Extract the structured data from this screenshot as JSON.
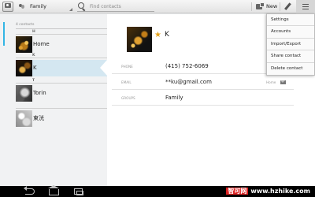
{
  "action_bar": {
    "account_filter": "Family",
    "search_placeholder": "Find contacts",
    "new_label": "New"
  },
  "contact_list": {
    "count_label": "4 contacts",
    "sections": [
      {
        "letter": "H",
        "contacts": [
          {
            "name": "Home",
            "selected": false
          }
        ]
      },
      {
        "letter": "K",
        "contacts": [
          {
            "name": "K",
            "selected": true
          }
        ]
      },
      {
        "letter": "T",
        "contacts": [
          {
            "name": "Torin",
            "selected": false
          }
        ]
      },
      {
        "letter": "",
        "contacts": [
          {
            "name": "東洸",
            "selected": false
          }
        ]
      }
    ]
  },
  "contact_detail": {
    "name": "K",
    "starred": true,
    "fields": [
      {
        "label": "PHONE",
        "value": "(415) 752-6069",
        "type": ""
      },
      {
        "label": "EMAIL",
        "value": "**ku@gmail.com",
        "type": "Home"
      },
      {
        "label": "GROUPS",
        "value": "Family",
        "type": ""
      }
    ]
  },
  "overflow_menu": {
    "items": [
      "Settings",
      "Accounts",
      "Import/Export",
      "Share contact",
      "Delete contact"
    ]
  },
  "watermark": {
    "chinese": "智可网",
    "url": "www.hzhike.com"
  },
  "colors": {
    "accent": "#33b5e5",
    "selected_row": "#d4e7f1",
    "star": "#e5a21b"
  }
}
